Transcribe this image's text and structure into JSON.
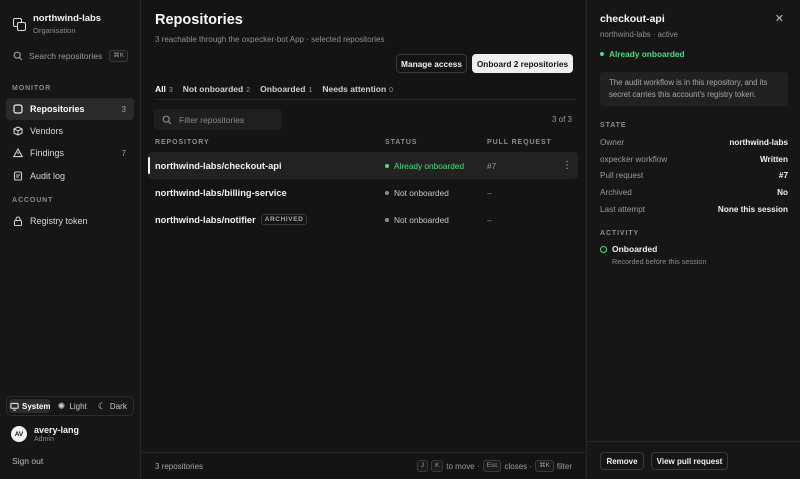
{
  "org": {
    "name": "northwind-labs",
    "subtitle": "Organisation"
  },
  "sidebar_search": {
    "label": "Search repositories",
    "shortcut": "⌘K"
  },
  "sidebar": {
    "monitor_label": "MONITOR",
    "items": [
      {
        "label": "Repositories",
        "count": "3",
        "icon": "repository-icon"
      },
      {
        "label": "Vendors",
        "count": "",
        "icon": "vendors-icon"
      },
      {
        "label": "Findings",
        "count": "7",
        "icon": "warning-icon"
      },
      {
        "label": "Audit log",
        "count": "",
        "icon": "document-icon"
      }
    ],
    "account_label": "ACCOUNT",
    "account_items": [
      {
        "label": "Registry token",
        "icon": "lock-icon"
      }
    ]
  },
  "theme": {
    "options": [
      "System",
      "Light",
      "Dark"
    ],
    "selected": "System"
  },
  "user": {
    "initials": "AV",
    "name": "avery-lang",
    "role": "Admin"
  },
  "signout": "Sign out",
  "main": {
    "title": "Repositories",
    "subtitle": "3 reachable through the oxpecker-bot App · selected repositories",
    "manage_access": "Manage access",
    "onboard": "Onboard 2 repositories",
    "tabs": [
      {
        "label": "All",
        "count": "3",
        "active": true
      },
      {
        "label": "Not onboarded",
        "count": "2"
      },
      {
        "label": "Onboarded",
        "count": "1"
      },
      {
        "label": "Needs attention",
        "count": "0"
      }
    ],
    "filter_placeholder": "Filter repositories",
    "range": "3 of 3",
    "columns": [
      "REPOSITORY",
      "STATUS",
      "PULL REQUEST"
    ],
    "rows": [
      {
        "repo": "northwind-labs/checkout-api",
        "badge": "",
        "status": "Already onboarded",
        "pr": "#7",
        "selected": true
      },
      {
        "repo": "northwind-labs/billing-service",
        "badge": "",
        "status": "Not onboarded",
        "pr": "–"
      },
      {
        "repo": "northwind-labs/notifier",
        "badge": "ARCHIVED",
        "status": "Not onboarded",
        "pr": "–"
      }
    ],
    "footer_count": "3 repositories",
    "hints": {
      "k1": "J",
      "k2": "K",
      "move": "to move ·",
      "k3": "Esc",
      "closes": "closes ·",
      "k4": "⌘K",
      "filter": "filter"
    }
  },
  "panel": {
    "title": "checkout-api",
    "subtitle": "northwind-labs · active",
    "onboarded": "Already onboarded",
    "note": "The audit workflow is in this repository, and its secret carries this account's registry token.",
    "state_label": "STATE",
    "state": [
      {
        "k": "Owner",
        "v": "northwind-labs"
      },
      {
        "k": "oxpecker workflow",
        "v": "Written"
      },
      {
        "k": "Pull request",
        "v": "#7"
      },
      {
        "k": "Archived",
        "v": "No"
      },
      {
        "k": "Last attempt",
        "v": "None this session"
      }
    ],
    "activity_label": "ACTIVITY",
    "activity": {
      "title": "Onboarded",
      "sub": "Recorded before this session"
    },
    "remove": "Remove",
    "view_pr": "View pull request"
  },
  "colors": {
    "success": "#4ade80",
    "background": "#141414"
  }
}
